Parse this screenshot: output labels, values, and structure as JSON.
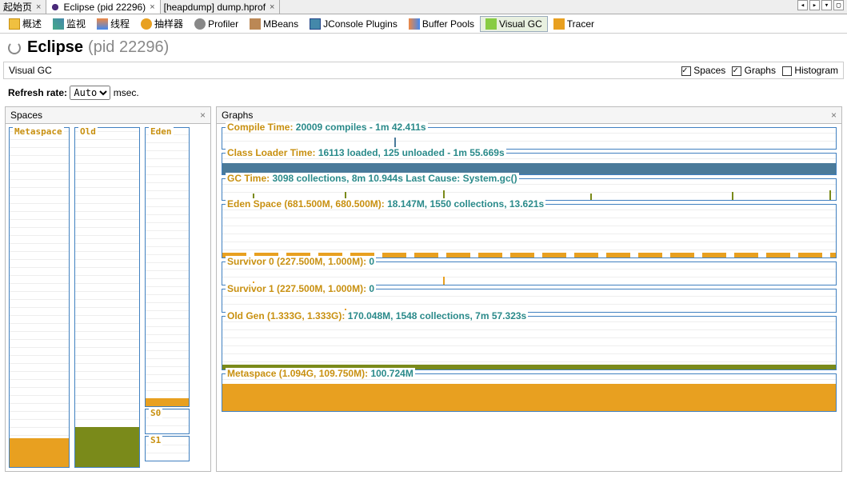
{
  "topTabs": [
    {
      "label": "起始页"
    },
    {
      "label": "Eclipse (pid 22296)"
    },
    {
      "label": "[heapdump] dump.hprof"
    }
  ],
  "toolbar": [
    {
      "name": "overview",
      "label": "概述"
    },
    {
      "name": "monitor",
      "label": "监视"
    },
    {
      "name": "threads",
      "label": "线程"
    },
    {
      "name": "sampler",
      "label": "抽样器"
    },
    {
      "name": "profiler",
      "label": "Profiler"
    },
    {
      "name": "mbeans",
      "label": "MBeans"
    },
    {
      "name": "jconsole",
      "label": "JConsole Plugins"
    },
    {
      "name": "buffer",
      "label": "Buffer Pools"
    },
    {
      "name": "visualgc",
      "label": "Visual GC"
    },
    {
      "name": "tracer",
      "label": "Tracer"
    }
  ],
  "header": {
    "title": "Eclipse",
    "pid": "(pid 22296)"
  },
  "subbar": {
    "label": "Visual GC",
    "spaces": "Spaces",
    "graphs": "Graphs",
    "histogram": "Histogram"
  },
  "refresh": {
    "label": "Refresh rate:",
    "value": "Auto",
    "unit": "msec."
  },
  "panels": {
    "spaces": "Spaces",
    "graphs": "Graphs"
  },
  "spaces": {
    "metaspace": "Metaspace",
    "old": "Old",
    "eden": "Eden",
    "s0": "S0",
    "s1": "S1"
  },
  "graphs": {
    "compile": {
      "p": "Compile Time: ",
      "v": "20009 compiles - 1m 42.411s"
    },
    "classloader": {
      "p": "Class Loader Time: ",
      "v": "16113 loaded, 125 unloaded - 1m 55.669s"
    },
    "gc": {
      "p": "GC Time: ",
      "v": "3098 collections, 8m 10.944s  Last Cause: System.gc()"
    },
    "eden": {
      "p": "Eden Space (681.500M, 680.500M): ",
      "v": "18.147M, 1550 collections, 13.621s"
    },
    "s0": {
      "p": "Survivor 0 (227.500M, 1.000M): ",
      "v": "0"
    },
    "s1": {
      "p": "Survivor 1 (227.500M, 1.000M): ",
      "v": "0"
    },
    "old": {
      "p": "Old Gen (1.333G, 1.333G): ",
      "v": "170.048M, 1548 collections, 7m 57.323s"
    },
    "meta": {
      "p": "Metaspace (1.094G, 109.750M): ",
      "v": "100.724M"
    }
  }
}
